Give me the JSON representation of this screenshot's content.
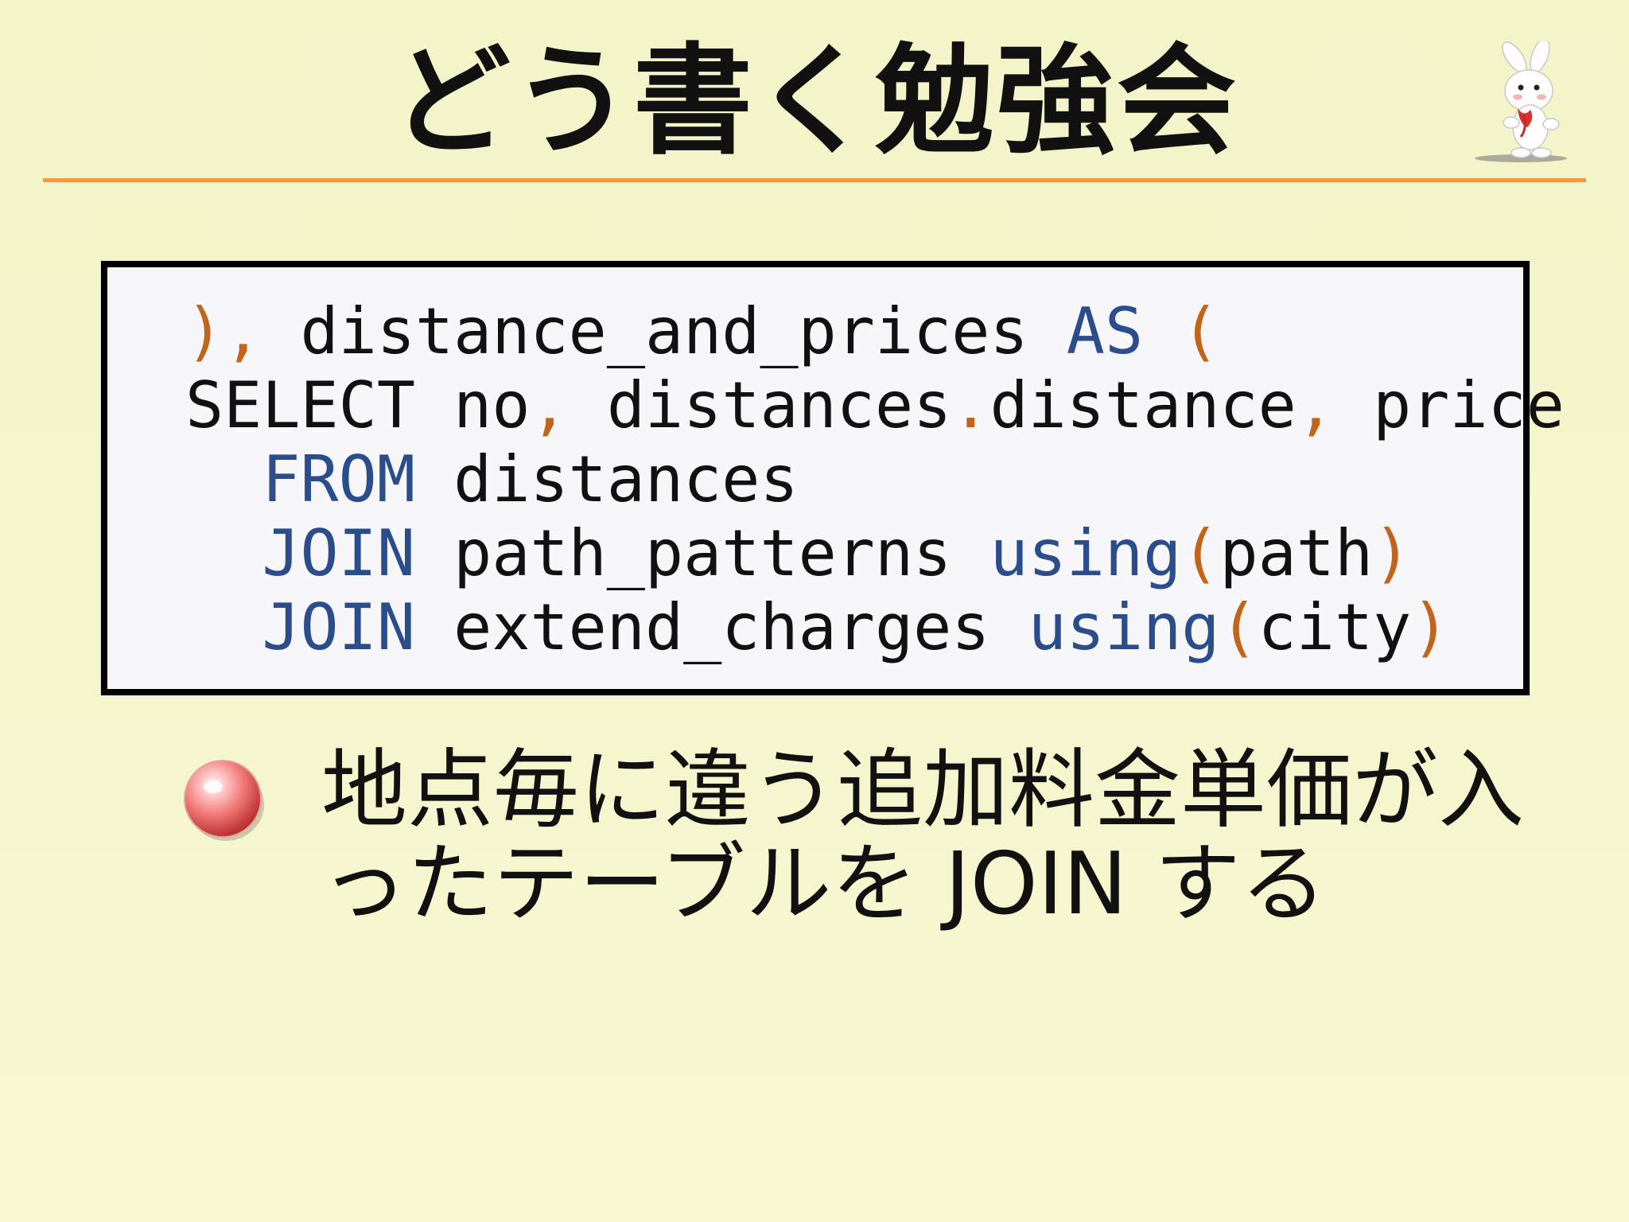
{
  "slide": {
    "title": "どう書く勉強会",
    "code": {
      "lines": [
        [
          {
            "t": "), ",
            "c": "pu"
          },
          {
            "t": "distance_and_prices ",
            "c": "tx"
          },
          {
            "t": "AS",
            "c": "kw"
          },
          {
            "t": " (",
            "c": "pu"
          }
        ],
        [
          {
            "t": "SELECT",
            "c": "tx"
          },
          {
            "t": " no",
            "c": "tx"
          },
          {
            "t": ",",
            "c": "pu"
          },
          {
            "t": " distances",
            "c": "tx"
          },
          {
            "t": ".",
            "c": "pu"
          },
          {
            "t": "distance",
            "c": "tx"
          },
          {
            "t": ",",
            "c": "pu"
          },
          {
            "t": " price",
            "c": "tx"
          }
        ],
        [
          {
            "t": "  ",
            "c": "tx"
          },
          {
            "t": "FROM",
            "c": "kw"
          },
          {
            "t": " distances",
            "c": "tx"
          }
        ],
        [
          {
            "t": "  ",
            "c": "tx"
          },
          {
            "t": "JOIN",
            "c": "kw"
          },
          {
            "t": " path_patterns ",
            "c": "tx"
          },
          {
            "t": "using",
            "c": "kw"
          },
          {
            "t": "(",
            "c": "pu"
          },
          {
            "t": "path",
            "c": "tx"
          },
          {
            "t": ")",
            "c": "pu"
          }
        ],
        [
          {
            "t": "  ",
            "c": "tx"
          },
          {
            "t": "JOIN",
            "c": "kw"
          },
          {
            "t": " extend_charges ",
            "c": "tx"
          },
          {
            "t": "using",
            "c": "kw"
          },
          {
            "t": "(",
            "c": "pu"
          },
          {
            "t": "city",
            "c": "tx"
          },
          {
            "t": ")",
            "c": "pu"
          }
        ]
      ]
    },
    "bullet": {
      "text": "地点毎に違う追加料金単価が入ったテーブルを JOIN する"
    },
    "icons": {
      "mascot": "rabbit-mascot-icon",
      "bullet": "red-ball-bullet-icon"
    },
    "colors": {
      "background": "#f6f6cf",
      "rule": "#ee9a45",
      "keyword": "#2b4d8c",
      "punctuation": "#c2641a"
    }
  }
}
